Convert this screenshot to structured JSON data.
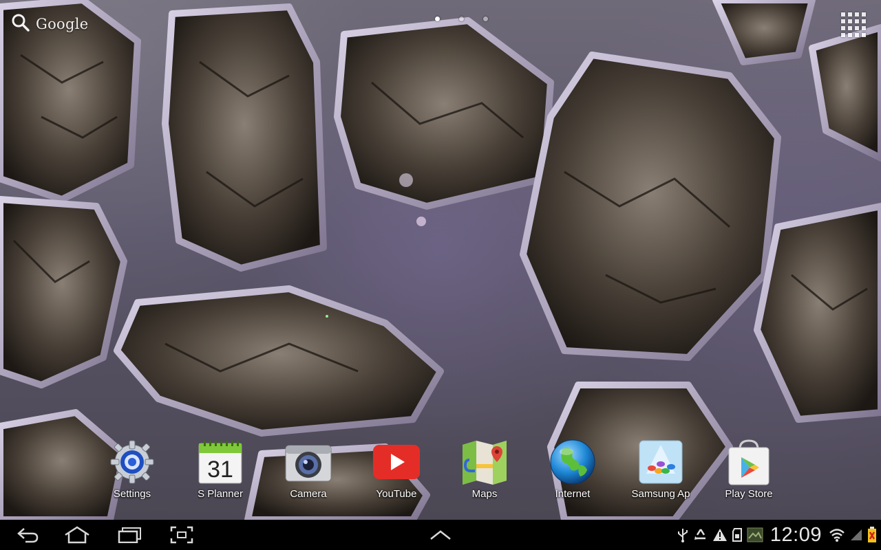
{
  "search": {
    "label": "Google",
    "icon": "search-icon"
  },
  "pages": {
    "count": 3,
    "active_index": 0
  },
  "apps_button": {
    "icon": "apps-grid-icon"
  },
  "dock": {
    "items": [
      {
        "label": "Settings",
        "icon": "settings-gear-icon"
      },
      {
        "label": "S Planner",
        "icon": "calendar-icon",
        "day": "31"
      },
      {
        "label": "Camera",
        "icon": "camera-icon"
      },
      {
        "label": "YouTube",
        "icon": "youtube-icon"
      },
      {
        "label": "Maps",
        "icon": "maps-icon"
      },
      {
        "label": "Internet",
        "icon": "globe-icon"
      },
      {
        "label": "Samsung Ap",
        "icon": "samsung-apps-icon"
      },
      {
        "label": "Play Store",
        "icon": "play-store-icon"
      }
    ]
  },
  "nav_bar": {
    "back_icon": "back-icon",
    "home_icon": "home-icon",
    "recent_icon": "recent-apps-icon",
    "screenshot_icon": "screenshot-icon",
    "up_icon": "chevron-up-icon"
  },
  "status": {
    "time": "12:09",
    "icons": [
      "usb-icon",
      "recycle-icon",
      "warning-icon",
      "sd-card-icon",
      "image-thumbnail-icon",
      "wifi-icon",
      "signal-icon",
      "battery-icon"
    ]
  },
  "colors": {
    "nav_background": "#000000",
    "youtube_red": "#e52d27",
    "globe_blue": "#1e88d6"
  }
}
